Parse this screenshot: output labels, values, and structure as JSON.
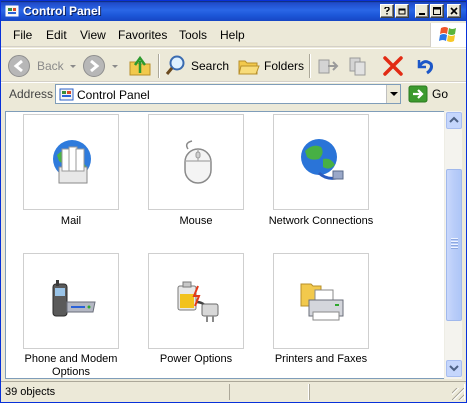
{
  "window": {
    "title": "Control Panel",
    "title_bar_color": "#1f55d8"
  },
  "menu": {
    "items": [
      "File",
      "Edit",
      "View",
      "Favorites",
      "Tools",
      "Help"
    ]
  },
  "toolbar": {
    "back_label": "Back",
    "search_label": "Search",
    "folders_label": "Folders"
  },
  "address": {
    "label": "Address",
    "value": "Control Panel",
    "go_label": "Go"
  },
  "content": {
    "items": [
      {
        "label": "Mail",
        "icon": "mail-icon"
      },
      {
        "label": "Mouse",
        "icon": "mouse-icon"
      },
      {
        "label": "Network Connections",
        "icon": "network-connections-icon"
      },
      {
        "label": "Phone and Modem Options",
        "icon": "phone-modem-icon"
      },
      {
        "label": "Power Options",
        "icon": "power-options-icon"
      },
      {
        "label": "Printers and Faxes",
        "icon": "printers-faxes-icon"
      }
    ]
  },
  "status": {
    "text": "39 objects"
  }
}
